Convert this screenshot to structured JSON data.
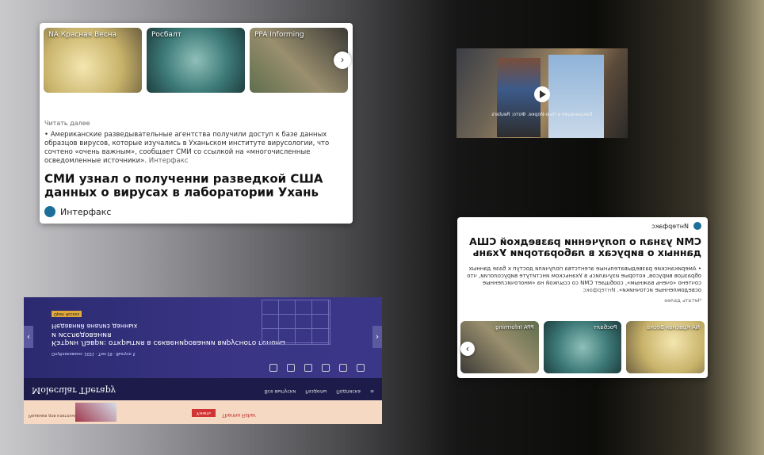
{
  "card": {
    "source": "Интерфакс",
    "headline": "СМИ узнал о полученни разведкой США данных о вирусах в лаборатории Ухань",
    "bullet": "Американские разведывательные агентства получили доступ к базе данных образцов вирусов, которые изучались в Уханьском институте вирусологии, что сочтено «очень важным», сообщает СМИ со ссылкой на «многочисленные осведомленные источники».",
    "attribution": "Интерфакс",
    "more": "Читать далее",
    "thumbs": [
      {
        "label": "NA Красная Весна"
      },
      {
        "label": "Росбалт"
      },
      {
        "label": "PPA Informing"
      }
    ]
  },
  "video": {
    "caption": "Вакцинация в Нью-Йорке. Фото: Reuters"
  },
  "journal": {
    "name": "Molecular Therapy",
    "nav": [
      "Все выпуски",
      "Разделы",
      "Подписка"
    ],
    "article_title": "Кэтрин Лаври: открытия в секвенировании вирусного генома и исследования",
    "article_sub": "Недавний анализ данных",
    "meta": "Опубликовано: 2021 · Том 29 · Выпуск 5",
    "badge": "Open Access",
    "ad_text": "Решения для клеточной терапии",
    "ad_button": "Узнать",
    "ad_brand": "Thermo Fisher",
    "icons": [
      "PDF",
      "Share",
      "Cite",
      "Save",
      "Alert",
      "Tools"
    ]
  }
}
